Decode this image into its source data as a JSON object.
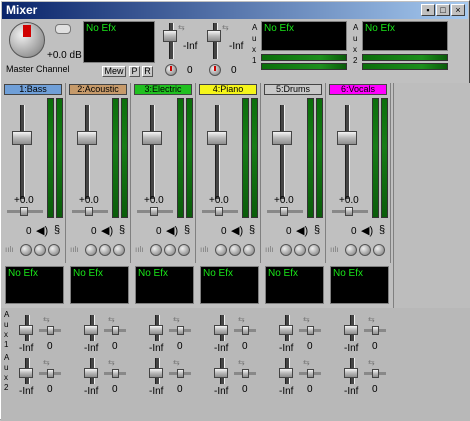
{
  "window": {
    "title": "Mixer"
  },
  "master": {
    "gain": "+0.0 dB",
    "label": "Master Channel",
    "efx": "No Efx",
    "buttons": [
      "Mew",
      "P",
      "R"
    ],
    "level_left": "-Inf",
    "level_right": "-Inf",
    "value_left": "0",
    "value_right": "0"
  },
  "aux_sends": [
    {
      "efx": "No Efx",
      "label": "A u x 1"
    },
    {
      "efx": "No Efx",
      "label": "A u x 2"
    }
  ],
  "channels": [
    {
      "name": "1:Bass",
      "color": "#6f9fd8",
      "level": "+0.0",
      "pan": "0",
      "efx": "No Efx"
    },
    {
      "name": "2:Acoustic",
      "color": "#c69a6a",
      "level": "+0.0",
      "pan": "0",
      "efx": "No Efx"
    },
    {
      "name": "3:Electric",
      "color": "#20c020",
      "level": "+0.0",
      "pan": "0",
      "efx": "No Efx"
    },
    {
      "name": "4:Piano",
      "color": "#f5f51a",
      "level": "+0.0",
      "pan": "0",
      "efx": "No Efx"
    },
    {
      "name": "5:Drums",
      "color": "#c8c8c8",
      "level": "+0.0",
      "pan": "0",
      "efx": "No Efx"
    },
    {
      "name": "6:Vocals",
      "color": "#ff00ff",
      "level": "+0.0",
      "pan": "0",
      "efx": "No Efx"
    }
  ],
  "aux_rows": [
    {
      "label": "A u x 1",
      "sends": [
        {
          "level": "-Inf",
          "pan": "0"
        },
        {
          "level": "-Inf",
          "pan": "0"
        },
        {
          "level": "-Inf",
          "pan": "0"
        },
        {
          "level": "-Inf",
          "pan": "0"
        },
        {
          "level": "-Inf",
          "pan": "0"
        },
        {
          "level": "-Inf",
          "pan": "0"
        }
      ]
    },
    {
      "label": "A u x 2",
      "sends": [
        {
          "level": "-Inf",
          "pan": "0"
        },
        {
          "level": "-Inf",
          "pan": "0"
        },
        {
          "level": "-Inf",
          "pan": "0"
        },
        {
          "level": "-Inf",
          "pan": "0"
        },
        {
          "level": "-Inf",
          "pan": "0"
        },
        {
          "level": "-Inf",
          "pan": "0"
        }
      ]
    }
  ]
}
